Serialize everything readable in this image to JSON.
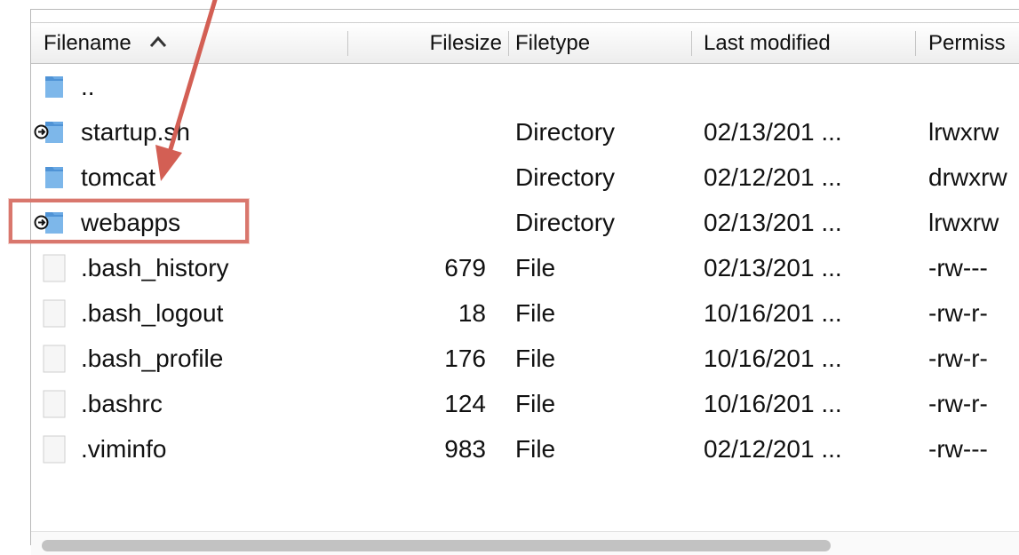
{
  "columns": {
    "filename": "Filename",
    "filesize": "Filesize",
    "filetype": "Filetype",
    "last_modified": "Last modified",
    "permissions": "Permiss"
  },
  "rows": [
    {
      "name": "..",
      "size": "",
      "type": "",
      "modified": "",
      "perm": "",
      "icon": "folder-icon"
    },
    {
      "name": "startup.sh",
      "size": "",
      "type": "Directory",
      "modified": "02/13/201 ...",
      "perm": "lrwxrw",
      "icon": "folder-link-icon"
    },
    {
      "name": "tomcat",
      "size": "",
      "type": "Directory",
      "modified": "02/12/201 ...",
      "perm": "drwxrw",
      "icon": "folder-icon"
    },
    {
      "name": "webapps",
      "size": "",
      "type": "Directory",
      "modified": "02/13/201 ...",
      "perm": "lrwxrw",
      "icon": "folder-link-icon"
    },
    {
      "name": ".bash_history",
      "size": "679",
      "type": "File",
      "modified": "02/13/201 ...",
      "perm": "-rw---",
      "icon": "file-icon"
    },
    {
      "name": ".bash_logout",
      "size": "18",
      "type": "File",
      "modified": "10/16/201 ...",
      "perm": "-rw-r-",
      "icon": "file-icon"
    },
    {
      "name": ".bash_profile",
      "size": "176",
      "type": "File",
      "modified": "10/16/201 ...",
      "perm": "-rw-r-",
      "icon": "file-icon"
    },
    {
      "name": ".bashrc",
      "size": "124",
      "type": "File",
      "modified": "10/16/201 ...",
      "perm": "-rw-r-",
      "icon": "file-icon"
    },
    {
      "name": ".viminfo",
      "size": "983",
      "type": "File",
      "modified": "02/12/201 ...",
      "perm": "-rw---",
      "icon": "file-icon"
    }
  ],
  "annotation": {
    "arrow_color": "#d35f54",
    "highlight_color": "#d9776d",
    "highlighted_row": "webapps"
  },
  "colors": {
    "folder_blue": "#5fa3e0",
    "header_border": "#c2c2c2"
  }
}
